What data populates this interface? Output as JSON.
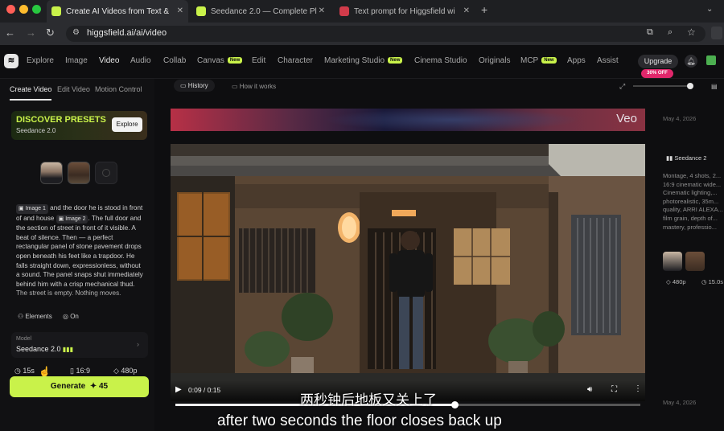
{
  "browser": {
    "tabs": [
      {
        "title": "Create AI Videos from Text &",
        "active": true
      },
      {
        "title": "Seedance 2.0 — Complete Pl",
        "active": false
      },
      {
        "title": "Text prompt for Higgsfield wi",
        "active": false
      }
    ],
    "url": "higgsfield.ai/ai/video"
  },
  "nav": {
    "items": [
      "Explore",
      "Image",
      "Video",
      "Audio",
      "Collab",
      "Canvas",
      "Edit",
      "Character",
      "Marketing Studio",
      "Cinema Studio",
      "Originals",
      "MCP",
      "Apps",
      "Assist"
    ],
    "new_badge": "New",
    "upgrade": "Upgrade",
    "discount": "30% OFF"
  },
  "left": {
    "tabs": [
      "Create Video",
      "Edit Video",
      "Motion Control"
    ],
    "preset_title": "DISCOVER PRESETS",
    "preset_subtitle": "Seedance 2.0",
    "explore": "Explore",
    "prompt_chip1": "Image 1",
    "prompt_part1": " and the door he is stood in front of and house ",
    "prompt_chip2": "Image 2",
    "prompt_part2": ". The full door and the section of street in front of it visible. A beat of silence. Then — a perfect rectangular panel of stone pavement drops open beneath his feet like a trapdoor. He falls straight down, expressionless, without a sound. The panel snaps shut immediately behind him with a crisp mechanical thud. The street is empty. Nothing moves.",
    "elements": "Elements",
    "on": "On",
    "model_label": "Model",
    "model_value": "Seedance 2.0",
    "duration": "15s",
    "ratio": "16:9",
    "resolution": "480p",
    "generate": "Generate",
    "credits": "45"
  },
  "center": {
    "history": "History",
    "how": "How it works",
    "veo": "Veo",
    "time": "0:09 / 0:15",
    "progress": 0.6
  },
  "subtitles": {
    "zh": "两秒钟后地板又关上了",
    "en": "after two seconds the floor closes back up"
  },
  "right": {
    "date1": "May 4, 2026",
    "model": "Seedance 2",
    "desc": "Montage, 4 shots, 2... 16:9 cinematic wide... Cinematic lighting,... photorealistic, 35m... quality, ARRI ALEXA... film grain, depth of... mastery, professio...",
    "res": "480p",
    "dur": "15.0s",
    "date2": "May 4, 2026"
  },
  "colors": {
    "accent": "#c9f24a",
    "discount": "#e0276b"
  }
}
